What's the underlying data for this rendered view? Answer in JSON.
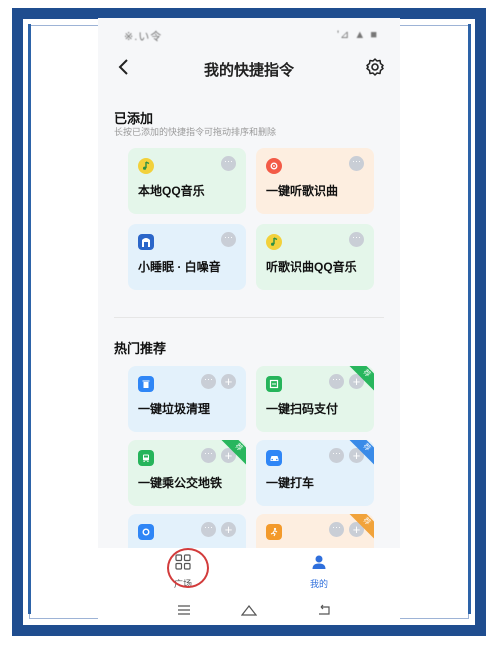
{
  "status_bar": {
    "left_text": "※.い令",
    "right_text": "'⊿ ▲ ■"
  },
  "header": {
    "title": "我的快捷指令"
  },
  "added": {
    "title": "已添加",
    "subtitle": "长按已添加的快捷指令可拖动排序和删除",
    "items": [
      {
        "label": "本地QQ音乐",
        "icon": "qq-music-icon",
        "color": "#f2d13b",
        "more": "···"
      },
      {
        "label": "一键听歌识曲",
        "icon": "music-recognize-icon",
        "color": "#f35b47",
        "more": "···"
      },
      {
        "label": "小睡眠 · 白噪音",
        "icon": "sleep-icon",
        "color": "#2b66c9",
        "more": "···"
      },
      {
        "label": "听歌识曲QQ音乐",
        "icon": "qq-music-icon",
        "color": "#f2d13b",
        "more": "···"
      }
    ]
  },
  "hot": {
    "title": "热门推荐",
    "items": [
      {
        "label": "一键垃圾清理",
        "icon": "trash-icon",
        "color": "#2f86f6",
        "more": "···",
        "add": "+"
      },
      {
        "label": "一键扫码支付",
        "icon": "scan-pay-icon",
        "color": "#26b45b",
        "more": "···",
        "add": "+",
        "badge": "荐",
        "badge_color": "#28b65d"
      },
      {
        "label": "一键乘公交地铁",
        "icon": "bus-icon",
        "color": "#26b45b",
        "more": "···",
        "add": "+",
        "badge": "荐",
        "badge_color": "#28b65d"
      },
      {
        "label": "一键打车",
        "icon": "car-icon",
        "color": "#2f86f6",
        "more": "···",
        "add": "+",
        "badge": "荐",
        "badge_color": "#3a8be8"
      },
      {
        "label": "",
        "icon": "settings-icon",
        "color": "#2f86f6",
        "more": "···",
        "add": "+"
      },
      {
        "label": "",
        "icon": "run-icon",
        "color": "#f39a2b",
        "more": "···",
        "add": "+",
        "badge": "荐",
        "badge_color": "#f1a33b"
      }
    ]
  },
  "bottom_nav": {
    "items": [
      {
        "label": "广场",
        "icon": "grid-icon"
      },
      {
        "label": "我的",
        "icon": "user-icon",
        "color": "#2f6fdc"
      }
    ]
  }
}
